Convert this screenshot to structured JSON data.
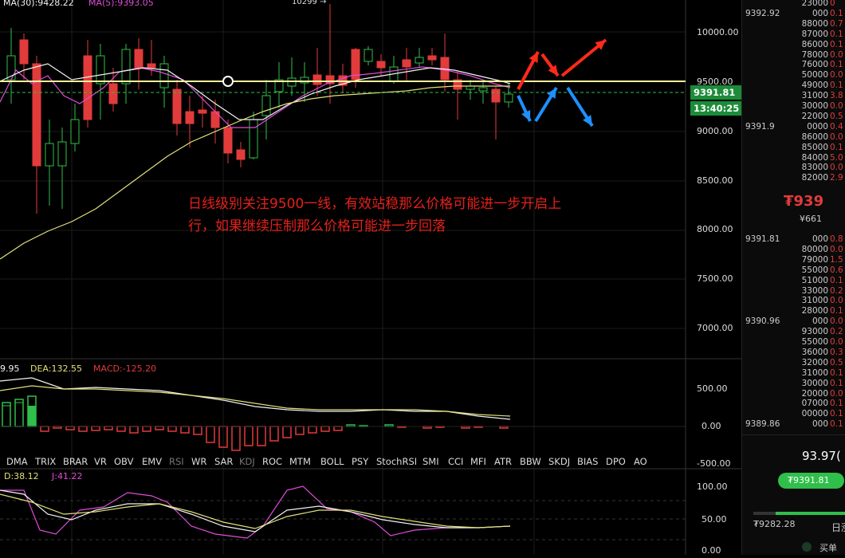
{
  "indicators_top": {
    "ma30": "MA(30):9428.22",
    "ma5": "MA(5):9393.05",
    "peak_label": "10299 →"
  },
  "price_axis": [
    "10000.00",
    "9500.00",
    "9000.00",
    "8500.00",
    "8000.00",
    "7500.00",
    "7000.00"
  ],
  "price_tags": {
    "current": "9391.81",
    "time": "13:40:25"
  },
  "note": {
    "line1": "日线级别关注9500一线，有效站稳那么价格可能进一步开启上",
    "line2": "行，如果继续压制那么价格可能进一步回落"
  },
  "macd": {
    "dif": "9.95",
    "dea": "DEA:132.55",
    "macd": "MACD:-125.20",
    "axis": [
      "500.00",
      "0.00",
      "-500.00"
    ]
  },
  "kdj": {
    "d": "D:38.12",
    "j": "J:41.22",
    "axis": [
      "100.00",
      "50.00",
      "0.00"
    ]
  },
  "tabs": [
    "DMA",
    "TRIX",
    "BRAR",
    "VR",
    "OBV",
    "EMV",
    "RSI",
    "WR",
    "SAR",
    "KDJ",
    "ROC",
    "MTM",
    "BOLL",
    "PSY",
    "StochRSI",
    "SMI",
    "CCI",
    "MFI",
    "ATR",
    "BBW",
    "SKDJ",
    "BIAS",
    "DPO",
    "AO"
  ],
  "orderbook_asks": [
    {
      "p": "",
      "q": "23000",
      "q2": "0"
    },
    {
      "p": "9392.92",
      "q": "000",
      "q2": "0.1"
    },
    {
      "p": "",
      "q": "88000",
      "q2": "0.7"
    },
    {
      "p": "",
      "q": "87000",
      "q2": "0.1"
    },
    {
      "p": "",
      "q": "86000",
      "q2": "0.1"
    },
    {
      "p": "",
      "q": "78000",
      "q2": "0.0"
    },
    {
      "p": "",
      "q": "76000",
      "q2": "0.1"
    },
    {
      "p": "",
      "q": "50000",
      "q2": "0.0"
    },
    {
      "p": "",
      "q": "49000",
      "q2": "0.1"
    },
    {
      "p": "",
      "q": "31000",
      "q2": "3.8"
    },
    {
      "p": "",
      "q": "30000",
      "q2": "0.0"
    },
    {
      "p": "",
      "q": "22000",
      "q2": "0.5"
    },
    {
      "p": "9391.9",
      "q": "0000",
      "q2": "0.4"
    },
    {
      "p": "",
      "q": "86000",
      "q2": "0.0"
    },
    {
      "p": "",
      "q": "85000",
      "q2": "0.1"
    },
    {
      "p": "",
      "q": "84000",
      "q2": "5.0"
    },
    {
      "p": "",
      "q": "83000",
      "q2": "0.0"
    },
    {
      "p": "",
      "q": "82000",
      "q2": "2.9"
    }
  ],
  "last_price": {
    "big": "₮939",
    "cny": "¥661"
  },
  "orderbook_bids": [
    {
      "p": "9391.81",
      "q": "000",
      "q2": "0.8"
    },
    {
      "p": "",
      "q": "80000",
      "q2": "0.0"
    },
    {
      "p": "",
      "q": "79000",
      "q2": "1.5"
    },
    {
      "p": "",
      "q": "55000",
      "q2": "0.6"
    },
    {
      "p": "",
      "q": "51000",
      "q2": "0.1"
    },
    {
      "p": "",
      "q": "33000",
      "q2": "0.2"
    },
    {
      "p": "",
      "q": "31000",
      "q2": "0.0"
    },
    {
      "p": "",
      "q": "28000",
      "q2": "0.1"
    },
    {
      "p": "9390.96",
      "q": "000",
      "q2": "0.0"
    },
    {
      "p": "",
      "q": "93000",
      "q2": "0.2"
    },
    {
      "p": "",
      "q": "55000",
      "q2": "0.0"
    },
    {
      "p": "",
      "q": "36000",
      "q2": "0.3"
    },
    {
      "p": "",
      "q": "32000",
      "q2": "0.5"
    },
    {
      "p": "",
      "q": "31000",
      "q2": "0.1"
    },
    {
      "p": "",
      "q": "30000",
      "q2": "0.1"
    },
    {
      "p": "",
      "q": "20000",
      "q2": "0.0"
    },
    {
      "p": "",
      "q": "07000",
      "q2": "0.1"
    },
    {
      "p": "",
      "q": "00000",
      "q2": "0.1"
    },
    {
      "p": "9389.86",
      "q": "000",
      "q2": "0.1"
    }
  ],
  "bottom_panel": {
    "pct": "93.97(",
    "buy_price": "₮9391.81",
    "low": "₮9282.28",
    "day_label": "日涨",
    "buy_label": "买单"
  },
  "colors": {
    "up": "#2fbf4a",
    "down": "#e23b3b",
    "ma5": "#e04dd9",
    "ma30": "#f3f3f3",
    "ma60": "#e2e07a",
    "resist": "#f7f29a",
    "arrow_red": "#ff2a1a",
    "arrow_blue": "#1e90ff"
  }
}
